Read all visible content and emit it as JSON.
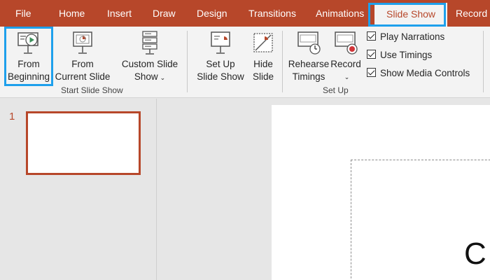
{
  "tabs": [
    {
      "label": "File"
    },
    {
      "label": "Home"
    },
    {
      "label": "Insert"
    },
    {
      "label": "Draw"
    },
    {
      "label": "Design"
    },
    {
      "label": "Transitions"
    },
    {
      "label": "Animations"
    },
    {
      "label": "Slide Show",
      "active": true
    },
    {
      "label": "Record"
    }
  ],
  "ribbon": {
    "start_group": {
      "label": "Start Slide Show",
      "from_beginning": {
        "line1": "From",
        "line2": "Beginning"
      },
      "from_current": {
        "line1": "From",
        "line2": "Current Slide"
      },
      "custom": {
        "line1": "Custom Slide",
        "line2": "Show"
      }
    },
    "setup_group": {
      "label": "Set Up",
      "setup_show": {
        "line1": "Set Up",
        "line2": "Slide Show"
      },
      "hide_slide": {
        "line1": "Hide",
        "line2": "Slide"
      },
      "rehearse": {
        "line1": "Rehearse",
        "line2": "Timings"
      },
      "record": {
        "line1": "Record"
      },
      "checkboxes": [
        {
          "label": "Play Narrations",
          "checked": true
        },
        {
          "label": "Use Timings",
          "checked": true
        },
        {
          "label": "Show Media Controls",
          "checked": true
        }
      ]
    }
  },
  "thumbnails": {
    "number": "1"
  },
  "slide": {
    "placeholder_text": "C"
  },
  "colors": {
    "accent": "#b7472a",
    "highlight": "#1ea0ec",
    "play_green": "#3a8f5a",
    "record_red": "#d13438"
  }
}
